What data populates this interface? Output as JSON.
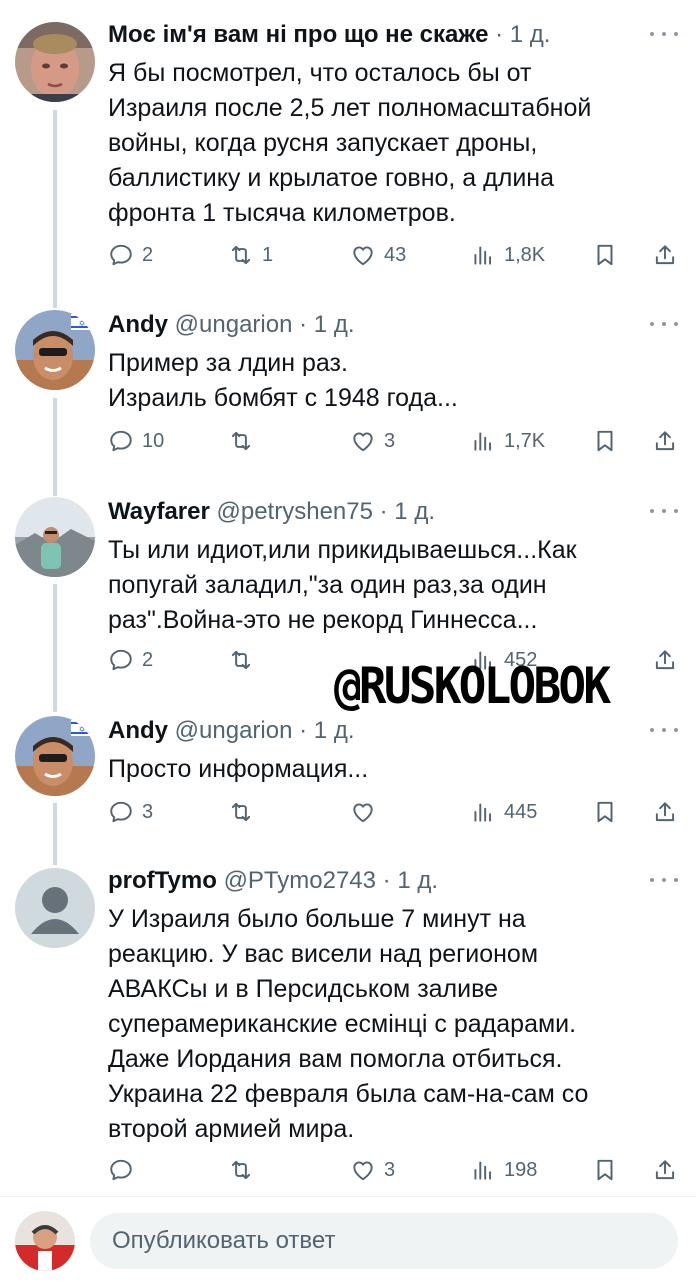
{
  "tweets": [
    {
      "name": "Моє ім'я вам ні про що не скаже",
      "handle": "",
      "separator": "·",
      "time": "1 д.",
      "text": "Я бы посмотрел, что осталось бы от\nИзраиля после 2,5 лет полномасштабной\nвойны, когда русня запускает дроны,\nбаллистику и крылатое говно, а длина\nфронта 1 тысяча километров.",
      "replies": "2",
      "retweets": "1",
      "likes": "43",
      "views": "1,8K"
    },
    {
      "name": "Andy",
      "handle": "@ungarion",
      "separator": "·",
      "time": "1 д.",
      "text": "Пример за лдин раз.\nИзраиль бомбят с 1948 года...",
      "replies": "10",
      "retweets": "",
      "likes": "3",
      "views": "1,7K"
    },
    {
      "name": "Wayfarer",
      "handle": "@petryshen75",
      "separator": "·",
      "time": "1 д.",
      "text": "Ты или идиот,или прикидываешься...Как\nпопугай заладил,\"за один раз,за один\nраз\".Война-это не рекорд Гиннесса...",
      "replies": "2",
      "retweets": "",
      "likes": "",
      "views": "452"
    },
    {
      "name": "Andy",
      "handle": "@ungarion",
      "separator": "·",
      "time": "1 д.",
      "text": "Просто информация...",
      "replies": "3",
      "retweets": "",
      "likes": "",
      "views": "445"
    },
    {
      "name": "profTymo",
      "handle": "@PTymo2743",
      "separator": "·",
      "time": "1 д.",
      "text": "У Израиля было больше 7 минут на\nреакцию. У вас висели над регионом\nАВАКСы и в Персидськом заливе\nсуперамериканские есмінці с радарами.\nДаже Иордания вам помогла отбиться.\nУкраина 22 февраля была сам-на-сам со\nвторой армией мира.",
      "replies": "",
      "retweets": "",
      "likes": "3",
      "views": "198"
    }
  ],
  "reply_placeholder": "Опубликовать ответ",
  "watermark": "@RUSKOLOBOK",
  "icons": [
    "reply-icon",
    "retweet-icon",
    "like-icon",
    "views-icon",
    "bookmark-icon",
    "share-icon",
    "more-icon"
  ],
  "colors": {
    "text": "#0f1419",
    "muted": "#536471",
    "thread": "#cfd9de",
    "input_bg": "#eff3f4"
  }
}
